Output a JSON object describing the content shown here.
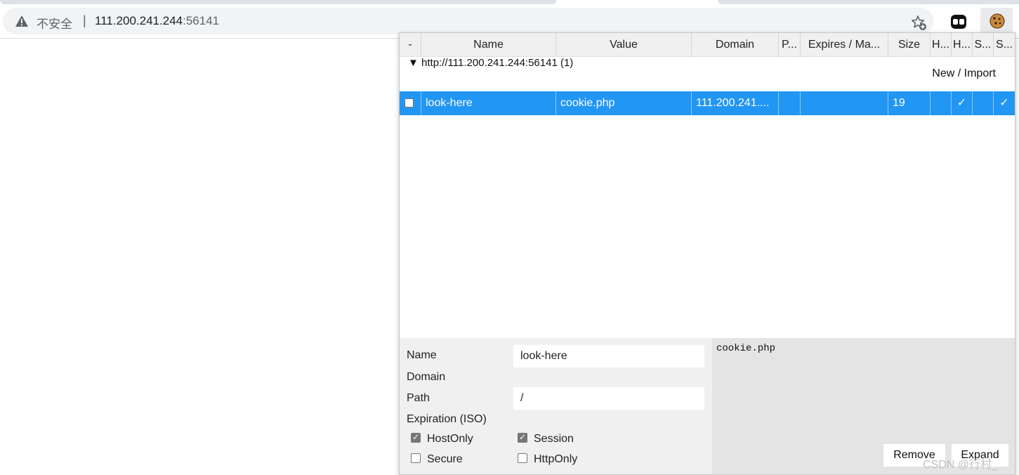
{
  "browser": {
    "security_label": "不安全",
    "separator": "|",
    "url_host": "111.200.241.244",
    "url_port": ":56141",
    "icons": {
      "warning": "warning-triangle-icon",
      "bookmark": "star-add-icon",
      "ext1": "extension-icon",
      "ext2": "cookie-icon"
    }
  },
  "cookie_panel": {
    "columns": [
      {
        "label": "-"
      },
      {
        "label": "Name"
      },
      {
        "label": "Value"
      },
      {
        "label": "Domain"
      },
      {
        "label": "P..."
      },
      {
        "label": "Expires / Ma..."
      },
      {
        "label": "Size"
      },
      {
        "label": "H..."
      },
      {
        "label": "H..."
      },
      {
        "label": "S..."
      },
      {
        "label": "S..."
      }
    ],
    "group_label": "▼ http://111.200.241.244:56141 (1)",
    "new_label": "New",
    "slash": " / ",
    "import_label": "Import",
    "rows": [
      {
        "name": "look-here",
        "value": "cookie.php",
        "domain": "111.200.241....",
        "path": "",
        "expires": "",
        "size": "19",
        "h1": "",
        "h2": "✓",
        "s1": "",
        "s2": "✓"
      }
    ],
    "selected_row_color": "#2196f3",
    "detail": {
      "name_label": "Name",
      "name_value": "look-here",
      "domain_label": "Domain",
      "path_label": "Path",
      "path_value": "/",
      "expiration_label": "Expiration (ISO)",
      "hostonly_label": "HostOnly",
      "session_label": "Session",
      "secure_label": "Secure",
      "httponly_label": "HttpOnly",
      "value_text": "cookie.php",
      "remove_label": "Remove",
      "expand_label": "Expand"
    }
  },
  "watermark": "CSDN @行村_"
}
